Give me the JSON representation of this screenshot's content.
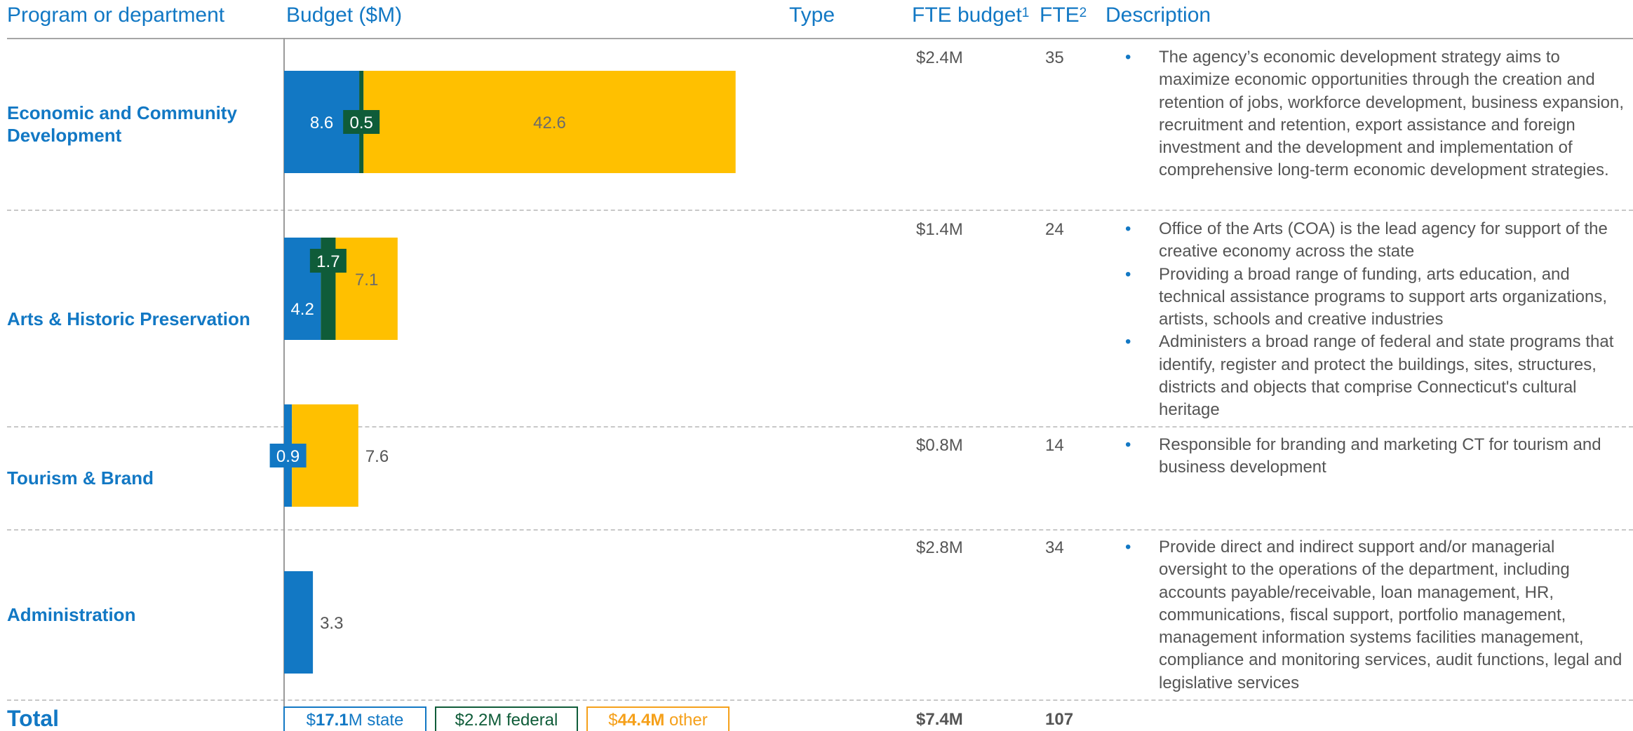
{
  "headers": {
    "program": "Program or department",
    "budget": "Budget ($M)",
    "type": "Type",
    "fte_budget": "FTE budget",
    "fte_budget_sup": "1",
    "fte": "FTE",
    "fte_sup": "2",
    "description": "Description"
  },
  "colors": {
    "state": "#1278c4",
    "federal": "#0f5c39",
    "other": "#ffc000",
    "header_text": "#1278c4"
  },
  "chart_data": {
    "type": "bar",
    "orientation": "horizontal-stacked",
    "categories": [
      "Economic and Community Development",
      "Arts & Historic Preservation",
      "Tourism & Brand",
      "Administration"
    ],
    "series": [
      {
        "name": "state",
        "values": [
          8.6,
          4.2,
          0.9,
          3.3
        ]
      },
      {
        "name": "federal",
        "values": [
          0.5,
          1.7,
          0,
          0
        ]
      },
      {
        "name": "other",
        "values": [
          42.6,
          7.1,
          7.6,
          0
        ]
      }
    ],
    "value_labels": [
      [
        "8.6",
        "0.5",
        "42.6"
      ],
      [
        "4.2",
        "1.7",
        "7.1"
      ],
      [
        "0.9",
        "",
        "7.6"
      ],
      [
        "3.3",
        "",
        ""
      ]
    ],
    "ylabel": "Budget ($M)",
    "grid": false
  },
  "rows": [
    {
      "program": "Economic and Community Development",
      "fte_budget": "$2.4M",
      "fte": "35",
      "description": [
        "The agency’s economic development strategy aims to maximize economic opportunities  through the creation and retention of jobs, workforce  development, business expansion,  recruitment  and retention, export assistance and foreign investment and the development and  implementation  of  comprehensive  long-term economic development strategies."
      ]
    },
    {
      "program": "Arts & Historic Preservation",
      "fte_budget": "$1.4M",
      "fte": "24",
      "description": [
        "Office of the Arts (COA) is the lead agency for support of the creative economy across the state",
        "Providing a broad range of funding, arts education, and technical assistance programs to support arts organizations, artists, schools and creative industries",
        "Administers a broad range of federal and state programs that identify, register and protect the buildings, sites, structures, districts and objects that comprise Connecticut's cultural heritage"
      ]
    },
    {
      "program": "Tourism & Brand",
      "fte_budget": "$0.8M",
      "fte": "14",
      "description": [
        "Responsible for branding and marketing CT for tourism and business development"
      ]
    },
    {
      "program": "Administration",
      "fte_budget": "$2.8M",
      "fte": "34",
      "description": [
        "Provide direct and indirect support and/or managerial oversight to the operations of the department, including accounts payable/receivable, loan management, HR, communications, fiscal support, portfolio management, management information systems facilities management, compliance and monitoring services, audit functions, legal and legislative services"
      ]
    }
  ],
  "total": {
    "label": "Total",
    "fte_budget": "$7.4M",
    "fte": "107",
    "legend": {
      "state_prefix": "$",
      "state_value": "17.1",
      "state_suffix": "M state",
      "federal_text": "$2.2M federal",
      "other_prefix": "$",
      "other_value": "44.4M",
      "other_suffix": " other"
    }
  }
}
